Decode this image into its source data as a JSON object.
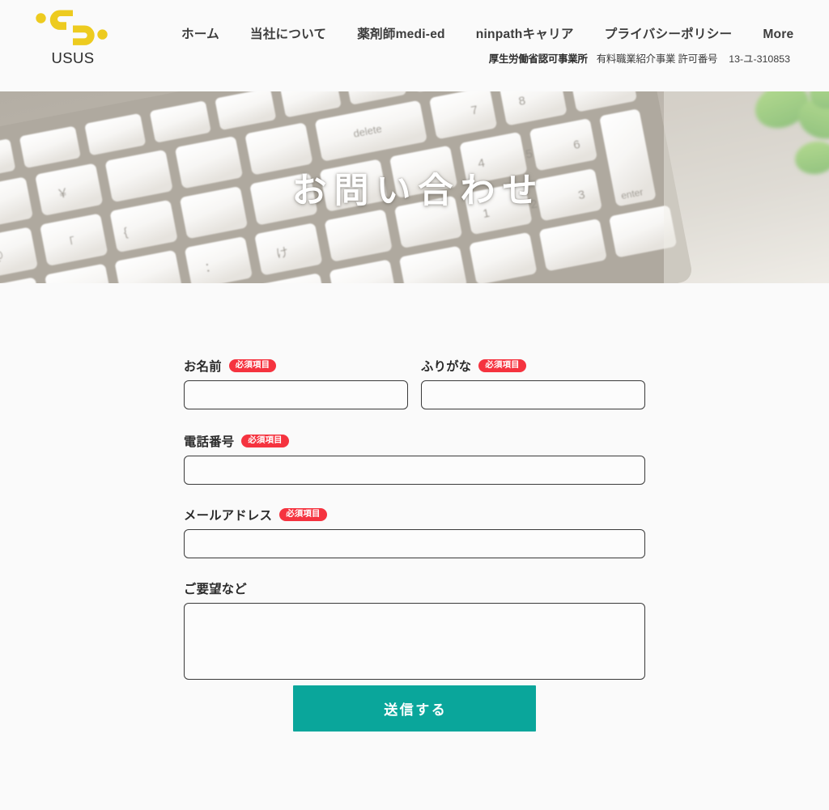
{
  "header": {
    "logo": {
      "wordmark": "USUS",
      "mark_name": "usus-logo-mark",
      "color": "#edcb1f"
    },
    "nav": [
      {
        "label": "ホーム",
        "name": "nav-home"
      },
      {
        "label": "当社について",
        "name": "nav-about"
      },
      {
        "label": "薬剤師medi-ed",
        "name": "nav-medi-ed"
      },
      {
        "label": "ninpathキャリア",
        "name": "nav-ninpath-career"
      },
      {
        "label": "プライバシーポリシー",
        "name": "nav-privacy-policy"
      },
      {
        "label": "More",
        "name": "nav-more"
      }
    ],
    "license": {
      "authority": "厚生労働省認可事業所",
      "service": "有料職業紹介事業 許可番号",
      "number": "13-ユ-310853"
    }
  },
  "hero": {
    "title": "お問い合わせ",
    "image_alt": "keyboard-photo"
  },
  "form": {
    "fields": [
      {
        "name": "name",
        "label": "お名前",
        "required_badge": "必須項目",
        "value": "",
        "placeholder": "",
        "type": "text"
      },
      {
        "name": "furigana",
        "label": "ふりがな",
        "required_badge": "必須項目",
        "value": "",
        "placeholder": "",
        "type": "text"
      },
      {
        "name": "phone",
        "label": "電話番号",
        "required_badge": "必須項目",
        "value": "",
        "placeholder": "",
        "type": "text"
      },
      {
        "name": "email",
        "label": "メールアドレス",
        "required_badge": "必須項目",
        "value": "",
        "placeholder": "",
        "type": "text"
      },
      {
        "name": "message",
        "label": "ご要望など",
        "required_badge": "",
        "value": "",
        "placeholder": "",
        "type": "textarea"
      }
    ],
    "submit_label": "送信する",
    "submit_color": "#0aa69b",
    "required_badge_color": "#f5333f"
  }
}
